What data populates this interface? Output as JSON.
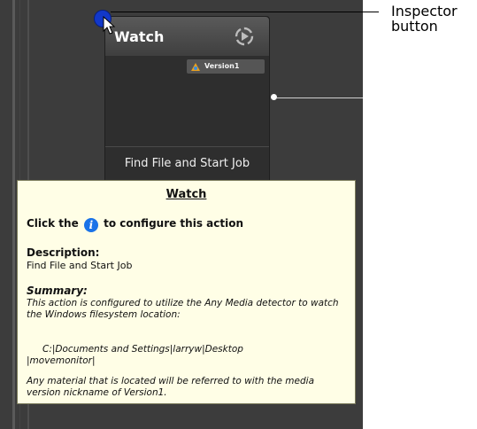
{
  "node": {
    "title": "Watch",
    "action_icon": "play-cycle-icon",
    "version_tag": {
      "icon": "media-detector-icon",
      "label": "Version1"
    },
    "footer": "Find File and Start Job"
  },
  "inspector": {
    "icon": "info-icon",
    "color": "#1238c9"
  },
  "callout": {
    "line1": "Inspector",
    "line2": "button"
  },
  "tooltip": {
    "title": "Watch",
    "click_prefix": "Click the",
    "click_icon": "i",
    "click_suffix": "to configure this action",
    "description_label": "Description:",
    "description_value": "Find File and Start Job",
    "summary_label": "Summary:",
    "summary_text": "This action is configured to utilize the Any Media detector to watch the Windows filesystem location:",
    "path_line1": "C:|Documents and Settings|larryw|Desktop",
    "path_line2": "|movemonitor|",
    "final_text": "Any material that is located will be referred to with the media version nickname of Version1."
  },
  "colors": {
    "canvas": "#3c3c3c",
    "tooltip_bg": "#fffee6",
    "info_badge": "#1a73e8"
  }
}
